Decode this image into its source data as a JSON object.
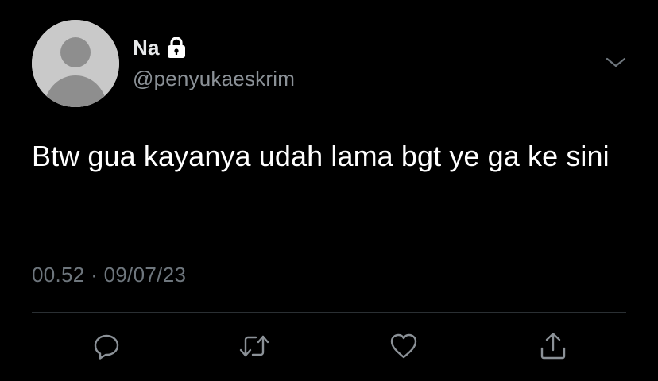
{
  "author": {
    "display_name": "Na",
    "handle": "@penyukaeskrim",
    "avatar_icon": "default-profile-icon",
    "protected_icon": "lock-icon"
  },
  "tweet": {
    "text": "Btw gua kayanya udah lama bgt ye ga ke sini",
    "time": "00.52",
    "separator": "·",
    "date": "09/07/23"
  },
  "menu_icon": "chevron-down-icon",
  "actions": [
    {
      "name": "reply",
      "icon": "reply-icon"
    },
    {
      "name": "retweet",
      "icon": "retweet-icon"
    },
    {
      "name": "like",
      "icon": "heart-icon"
    },
    {
      "name": "share",
      "icon": "share-icon"
    }
  ],
  "colors": {
    "background": "#000000",
    "primary_text": "#e7e9ea",
    "secondary_text": "#6e767d",
    "icon": "#8b9197"
  }
}
